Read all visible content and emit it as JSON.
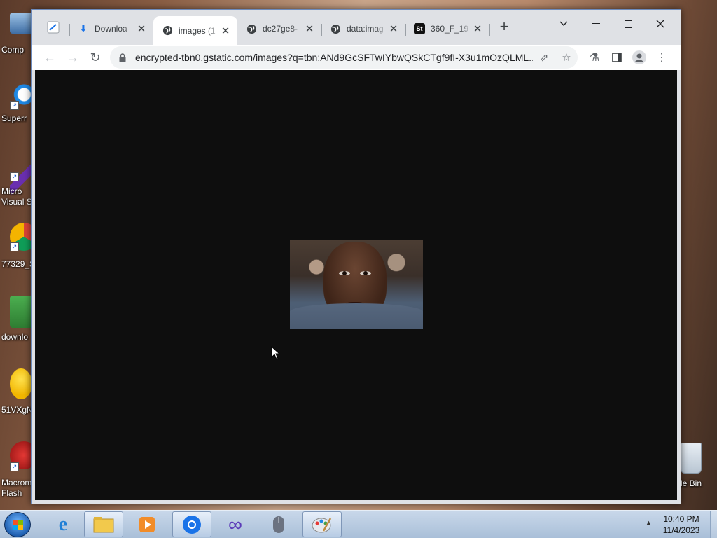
{
  "desktop": {
    "icons": [
      {
        "label": "Comp",
        "name": "computer-icon"
      },
      {
        "label": "Superr",
        "name": "superr-shortcut-icon"
      },
      {
        "label": "Micro",
        "label2": "Visual S",
        "name": "visual-studio-icon"
      },
      {
        "label": "77329_S",
        "name": "chrome-shortcut-icon"
      },
      {
        "label": "downlo",
        "name": "download-file-icon"
      },
      {
        "label": "51VXgN",
        "name": "duck-image-icon"
      },
      {
        "label": "Macrom",
        "label2": "Flash",
        "name": "flash-icon"
      }
    ],
    "recycle_bin_label": "cle Bin"
  },
  "browser": {
    "tabs": [
      {
        "title": "Downloa",
        "icon": "download-icon"
      },
      {
        "title": "images (1",
        "icon": "globe-icon",
        "active": true
      },
      {
        "title": "dc27ge8-",
        "icon": "globe-icon"
      },
      {
        "title": "data:imag",
        "icon": "globe-icon"
      },
      {
        "title": "360_F_19",
        "icon": "st-icon",
        "icon_text": "St"
      }
    ],
    "url": "encrypted-tbn0.gstatic.com/images?q=tbn:ANd9GcSFTwIYbwQSkCTgf9fI-X3u1mOzQLML...",
    "page_background": "#0e0e0e"
  },
  "taskbar": {
    "time": "10:40 PM",
    "date": "11/4/2023",
    "apps": [
      "internet-explorer-icon",
      "file-explorer-icon",
      "media-player-icon",
      "chrome-icon",
      "infinity-app-icon",
      "mouse-app-icon",
      "paint-icon"
    ]
  }
}
